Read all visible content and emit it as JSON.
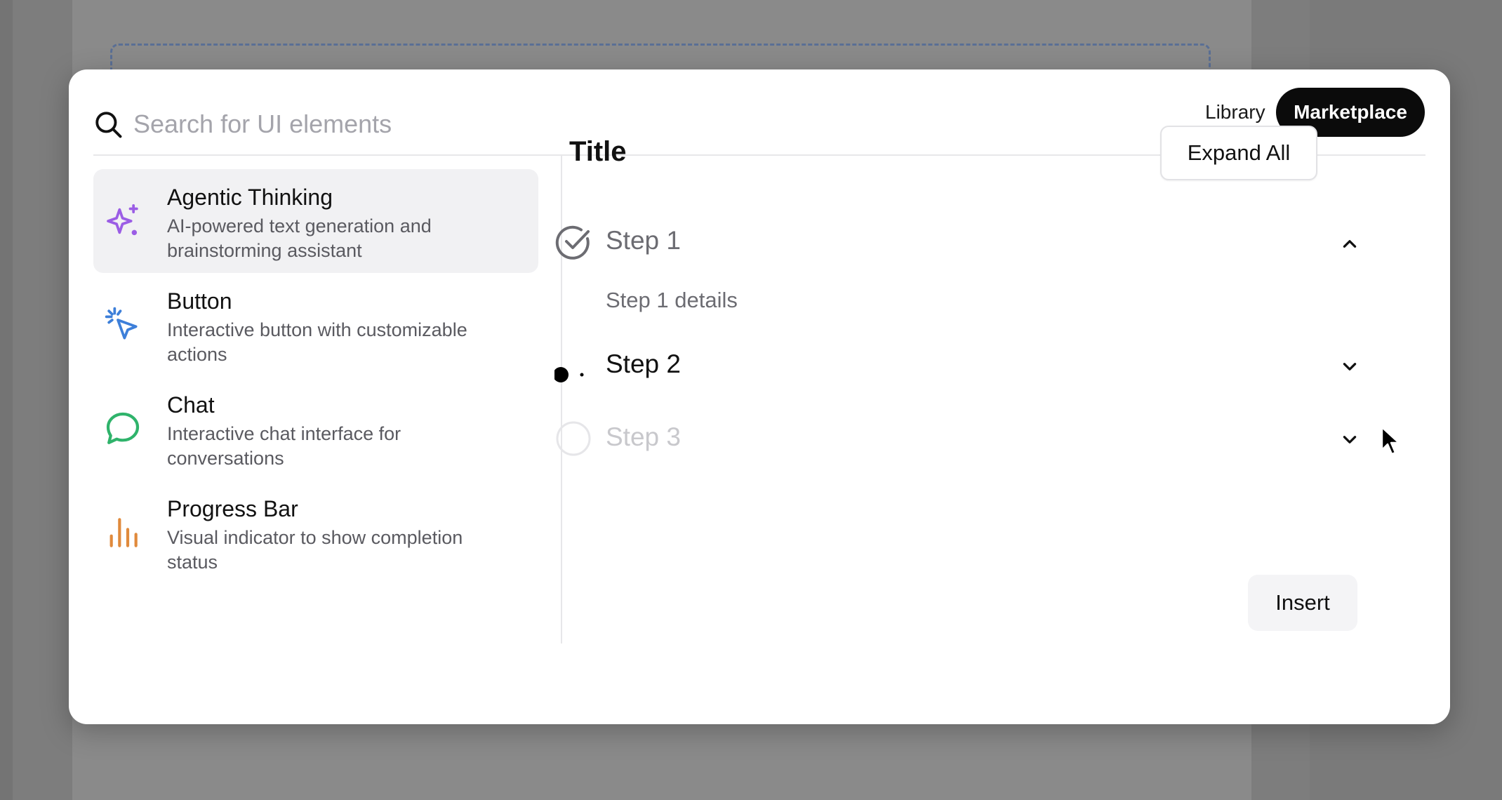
{
  "search": {
    "placeholder": "Search for UI elements"
  },
  "header": {
    "library_label": "Library",
    "marketplace_label": "Marketplace"
  },
  "components": [
    {
      "title": "Agentic Thinking",
      "description": "AI-powered text generation and brainstorming assistant",
      "icon": "sparkle-icon",
      "color": "#9b5de5",
      "selected": true
    },
    {
      "title": "Button",
      "description": "Interactive button with customizable actions",
      "icon": "cursor-click-icon",
      "color": "#3d7fd9",
      "selected": false
    },
    {
      "title": "Chat",
      "description": "Interactive chat interface for conversations",
      "icon": "chat-bubble-icon",
      "color": "#2fb36b",
      "selected": false
    },
    {
      "title": "Progress Bar",
      "description": "Visual indicator to show completion status",
      "icon": "bar-chart-icon",
      "color": "#e08a3c",
      "selected": false
    }
  ],
  "preview": {
    "title": "Title",
    "expand_all_label": "Expand All",
    "steps": [
      {
        "label": "Step 1",
        "status": "completed",
        "expanded": true,
        "details": "Step 1 details"
      },
      {
        "label": "Step 2",
        "status": "in-progress",
        "expanded": false
      },
      {
        "label": "Step 3",
        "status": "pending",
        "expanded": false
      }
    ]
  },
  "footer": {
    "insert_label": "Insert"
  }
}
